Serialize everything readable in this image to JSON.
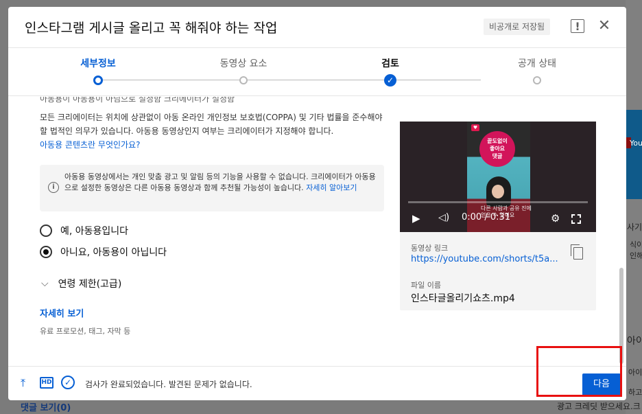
{
  "background": {
    "right_text_1": "You",
    "right_text_2": "사기",
    "right_text_3": "식이",
    "right_text_4": "인해",
    "right_text_5": "아이",
    "right_text_6": "아이",
    "right_text_7": "하고",
    "bottom_comments": "댓글 보기(0)",
    "bottom_right_text": "광고 크레딧 받으세요.크"
  },
  "dialog": {
    "title": "인스타그램 게시글 올리고 꼭 해줘야 하는 작업",
    "draft_badge": "비공개로 저장됨",
    "feedback_icon": "!",
    "close_icon": "✕"
  },
  "stepper": {
    "steps": [
      {
        "label": "세부정보",
        "state": "active"
      },
      {
        "label": "동영상 요소",
        "state": "pending"
      },
      {
        "label": "검토",
        "state": "done"
      },
      {
        "label": "공개 상태",
        "state": "pending"
      }
    ]
  },
  "audience": {
    "cut_text": "아동용이 아동용이 아님으로 설정함    크리에이터가 설정함",
    "paragraph": "모든 크리에이터는 위치에 상관없이 아동 온라인 개인정보 보호법(COPPA) 및 기타 법률을 준수해야 할 법적인 의무가 있습니다. 아동용 동영상인지 여부는 크리에이터가 지정해야 합니다.",
    "paragraph_link": "아동용 콘텐츠란 무엇인가요?",
    "info_text": "아동용 동영상에서는 개인 맞춤 광고 및 알림 등의 기능을 사용할 수 없습니다. 크리에이터가 아동용으로 설정한 동영상은 다른 아동용 동영상과 함께 추천될 가능성이 높습니다.",
    "info_link": "자세히 알아보기",
    "option_yes": "예, 아동용입니다",
    "option_no": "아니요, 아동용이 아닙니다",
    "selected": "no",
    "age_restriction": "연령 제한(고급)",
    "more_link": "자세히 보기",
    "more_sub": "유료 프로모션, 태그, 자막 등"
  },
  "preview": {
    "bubble_text": "끝도없이\n좋아요\n댓글",
    "caption": "다른 사람과 공유 진에\n얻을 수 있어요",
    "time": "0:00 / 0:31",
    "progress": 0.0,
    "link_label": "동영상 링크",
    "link": "https://youtube.com/shorts/t5a...",
    "file_label": "파일 이름",
    "file_name": "인스타글올리기쇼츠.mp4"
  },
  "footer": {
    "hd_label": "HD",
    "status": "검사가 완료되었습니다. 발견된 문제가 없습니다.",
    "next_button": "다음"
  },
  "colors": {
    "accent": "#065fd4",
    "highlight": "#e81010"
  }
}
